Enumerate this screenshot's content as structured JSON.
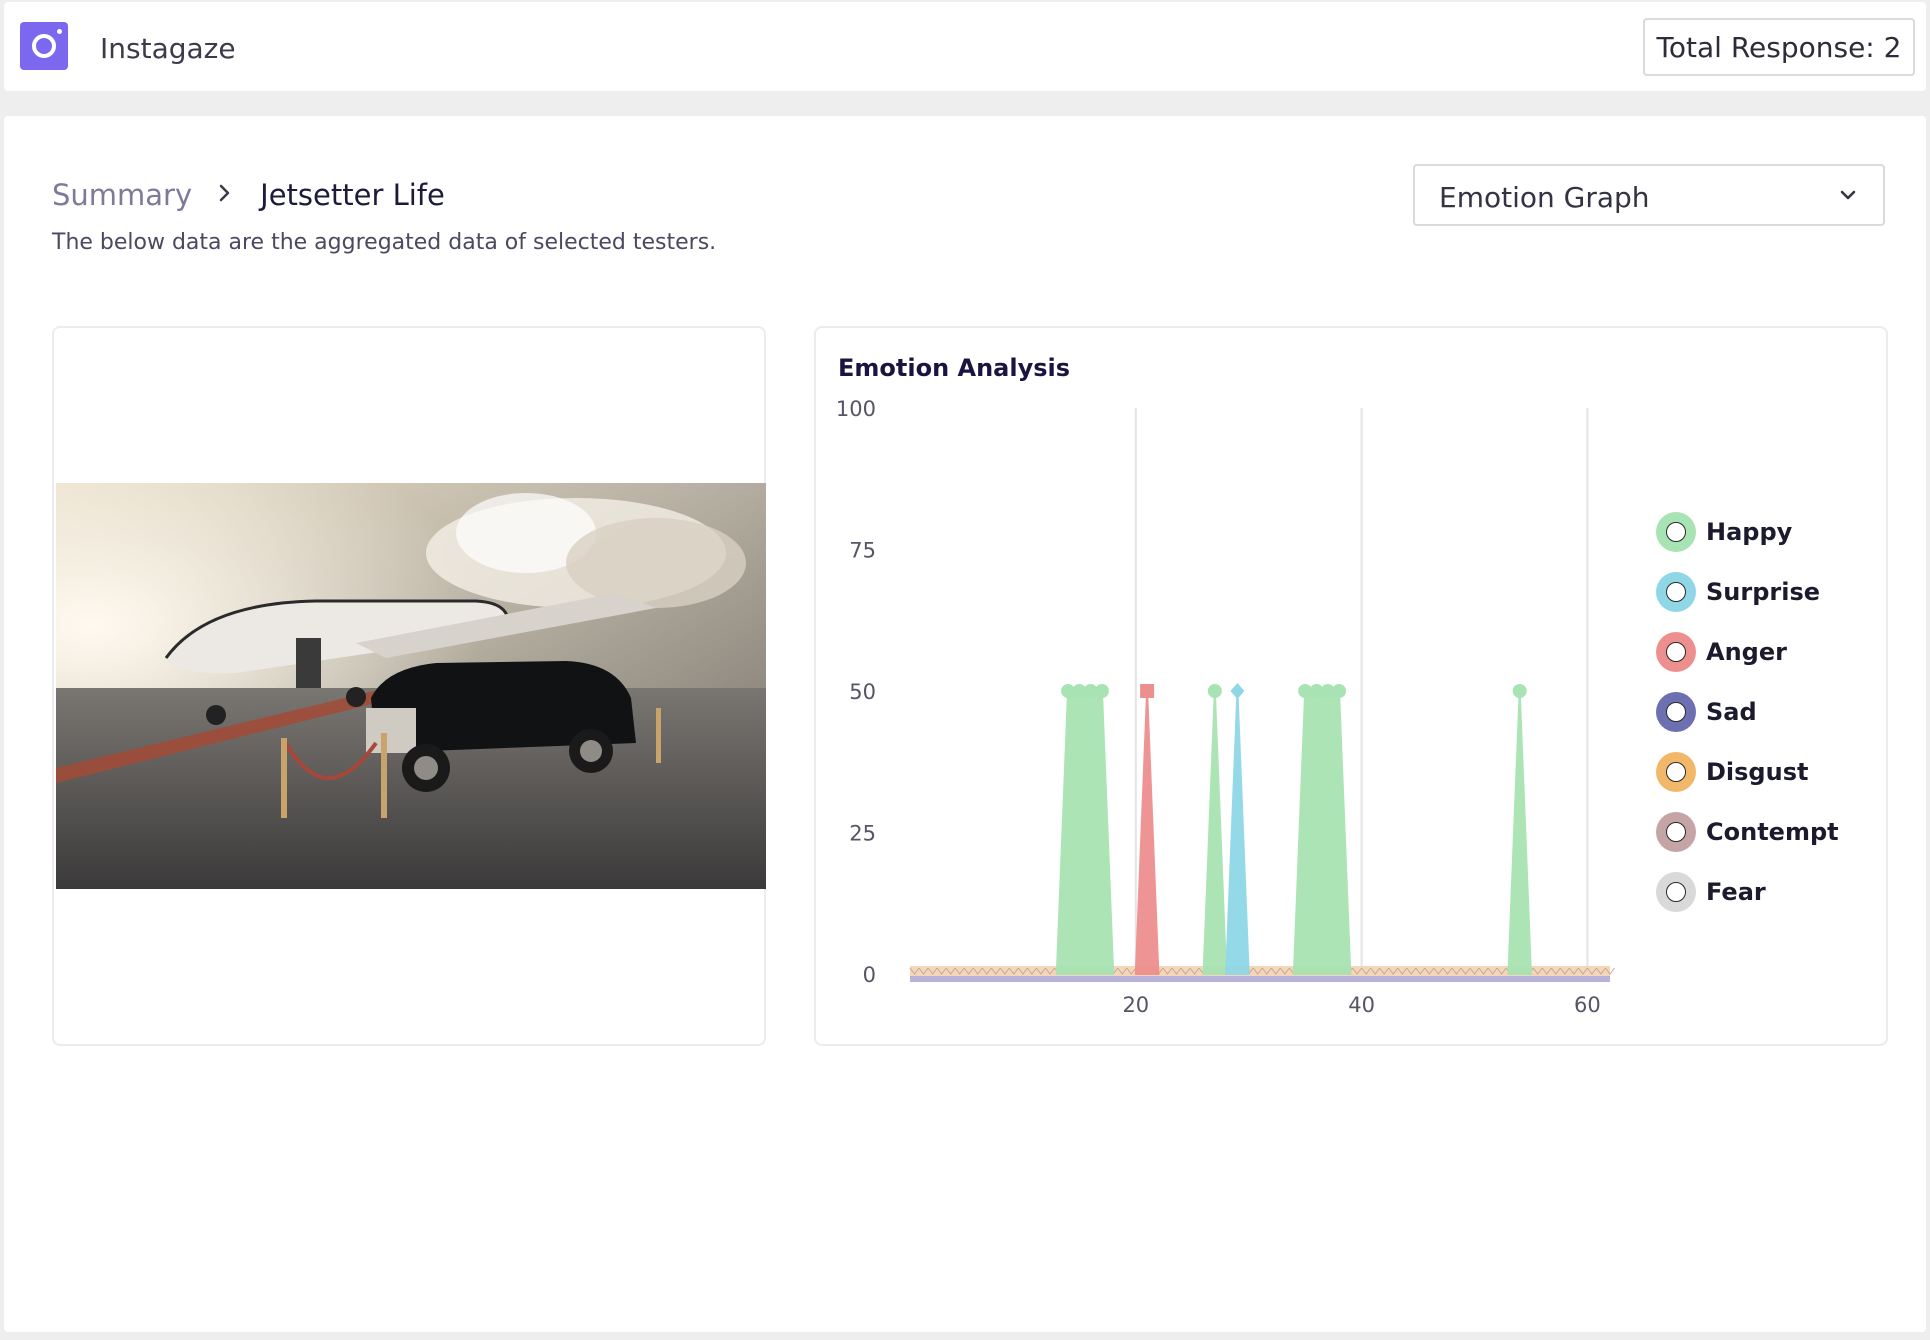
{
  "app": {
    "title": "Instagaze"
  },
  "header": {
    "total_response": "Total Response: 2"
  },
  "breadcrumb": {
    "root": "Summary",
    "current": "Jetsetter Life"
  },
  "subtitle": "The below data are the aggregated data of selected testers.",
  "view_select": {
    "value": "Emotion Graph"
  },
  "chart_data": {
    "type": "area",
    "title": "Emotion Analysis",
    "ylim": [
      0,
      100
    ],
    "yticks": [
      "100",
      "75",
      "50",
      "25",
      "0"
    ],
    "xlim": [
      0,
      62
    ],
    "xticks": [
      "20",
      "40",
      "60"
    ],
    "grid": "vertical",
    "legend_position": "right",
    "series": [
      {
        "name": "Happy",
        "color": "#a8e3b3",
        "x": [
          13,
          14,
          15,
          16,
          17,
          18,
          26,
          27,
          28,
          34,
          35,
          36,
          37,
          38,
          39,
          53,
          54,
          55
        ],
        "y": [
          0,
          50,
          50,
          50,
          50,
          0,
          0,
          50,
          0,
          0,
          50,
          50,
          50,
          50,
          0,
          0,
          50,
          0
        ]
      },
      {
        "name": "Surprise",
        "color": "#8fd7e6",
        "x": [
          28,
          29,
          30
        ],
        "y": [
          0,
          50,
          0
        ]
      },
      {
        "name": "Anger",
        "color": "#ee8f8f",
        "x": [
          20,
          21,
          22
        ],
        "y": [
          0,
          50,
          0
        ]
      },
      {
        "name": "Sad",
        "color": "#6c6fb0",
        "x": [],
        "y": []
      },
      {
        "name": "Disgust",
        "color": "#f2b86a",
        "x": [],
        "y": []
      },
      {
        "name": "Contempt",
        "color": "#c4a4a4",
        "x": [],
        "y": []
      },
      {
        "name": "Fear",
        "color": "#d9d9d9",
        "x": [],
        "y": []
      }
    ]
  },
  "icons": {
    "logo": "camera-ring-icon",
    "chevron": "chevron-down-icon",
    "breadcrumb_separator": "chevron-right-icon"
  }
}
